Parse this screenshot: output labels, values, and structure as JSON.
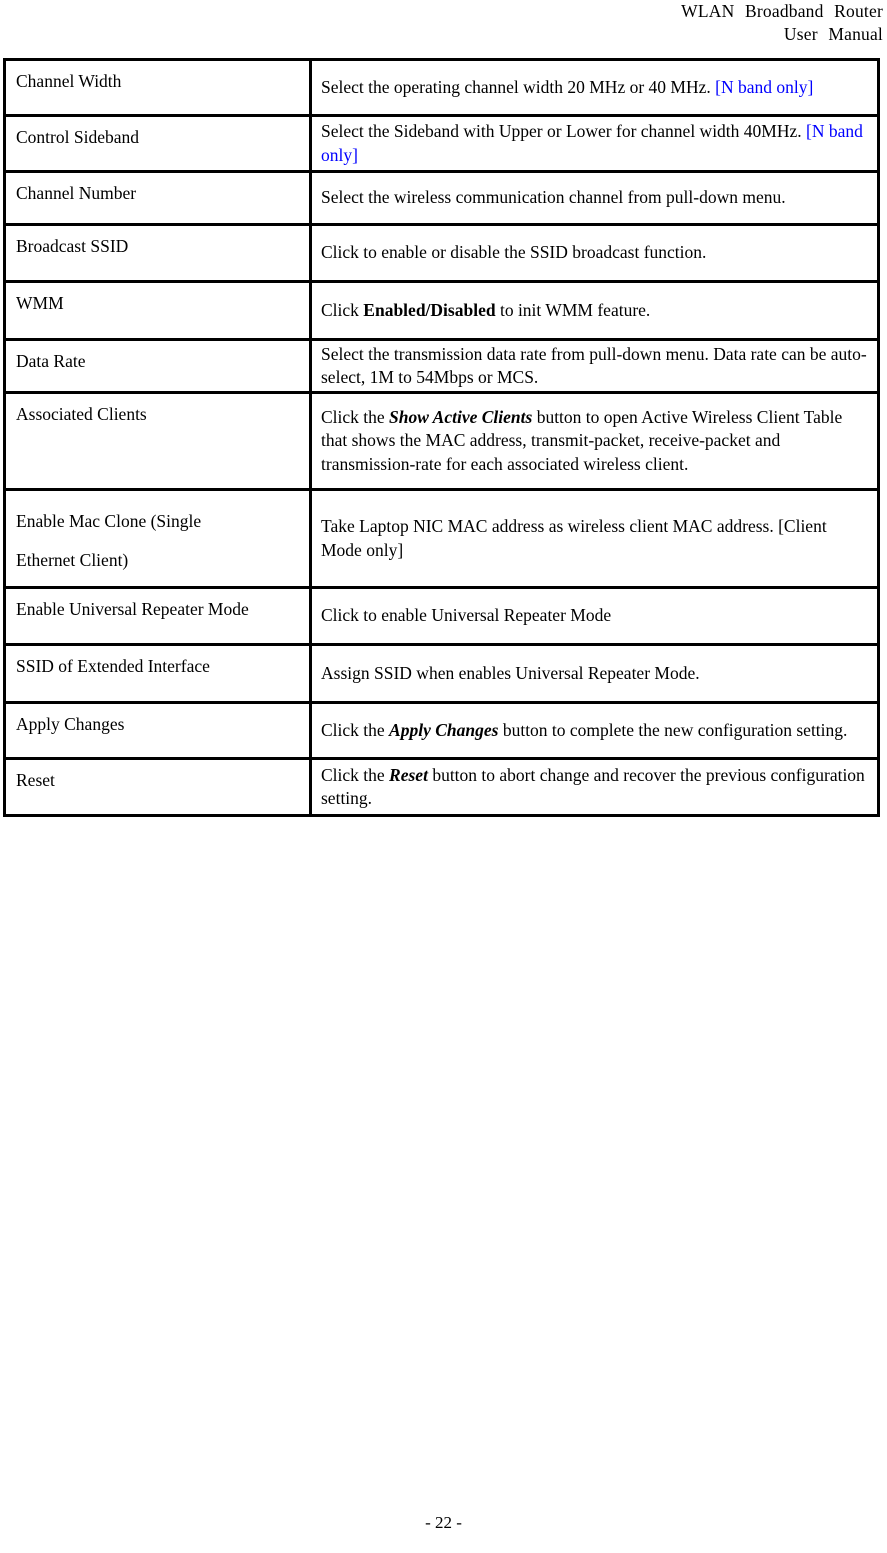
{
  "header": {
    "line1": "WLAN  Broadband  Router",
    "line2": "User  Manual"
  },
  "footer": {
    "page_label": "- 22 -"
  },
  "table": {
    "rows": [
      {
        "term": "Channel Width",
        "desc_plain": "Select the operating channel width 20 MHz or 40 MHz. [N band only]",
        "desc_parts": [
          {
            "text": "Select the operating channel width 20 MHz or 40 MHz.",
            "style": "normal"
          },
          {
            "text": " ",
            "style": "normal"
          },
          {
            "text": "[N band only]",
            "style": "blue"
          }
        ]
      },
      {
        "term": "Control Sideband",
        "desc_plain": "Select the Sideband with Upper or Lower for channel width 40MHz. [N band only]",
        "desc_parts": [
          {
            "text": "Select the Sideband with Upper or Lower for channel width 40MHz. ",
            "style": "normal"
          },
          {
            "text": "[N band only]",
            "style": "blue"
          }
        ]
      },
      {
        "term": "Channel Number",
        "desc_plain": "Select the wireless communication channel from pull-down menu.",
        "desc_parts": [
          {
            "text": "Select the wireless communication channel from pull-down menu.",
            "style": "normal"
          }
        ]
      },
      {
        "term": "Broadcast SSID",
        "desc_plain": "Click to enable or disable the SSID broadcast function.",
        "desc_parts": [
          {
            "text": "Click to enable or disable the SSID broadcast function.",
            "style": "normal"
          }
        ]
      },
      {
        "term": "WMM",
        "desc_plain": "Click Enabled/Disabled to init WMM feature.",
        "desc_parts": [
          {
            "text": "Click ",
            "style": "normal"
          },
          {
            "text": "Enabled/Disabled",
            "style": "bold"
          },
          {
            "text": " to init WMM feature.",
            "style": "normal"
          }
        ]
      },
      {
        "term": "Data Rate",
        "desc_plain": "Select the transmission data rate from pull-down menu. Data rate can be auto-select, 1M to 54Mbps or MCS.",
        "desc_parts": [
          {
            "text": "Select the transmission data rate from pull-down menu. Data rate can be auto-select, 1M to 54Mbps or MCS.",
            "style": "normal"
          }
        ]
      },
      {
        "term": "Associated Clients",
        "desc_plain": "Click the Show Active Clients button to open Active Wireless Client Table that shows the MAC address, transmit-packet, receive-packet and transmission-rate for each associated wireless client.",
        "desc_parts": [
          {
            "text": "Click the ",
            "style": "normal"
          },
          {
            "text": "Show Active Clients",
            "style": "bold-italic"
          },
          {
            "text": " button to open Active Wireless Client Table that shows the MAC address, transmit-packet, receive-packet and transmission-rate for each associated wireless client.",
            "style": "normal"
          }
        ]
      },
      {
        "term": "Enable Mac Clone (Single Ethernet Client)",
        "term_line1": "Enable Mac Clone (Single",
        "term_line2": "Ethernet Client)",
        "desc_plain": "Take Laptop NIC MAC address as wireless client MAC address. [Client Mode only]",
        "desc_parts": [
          {
            "text": "Take Laptop NIC MAC address as wireless client MAC address. [Client Mode only]",
            "style": "normal"
          }
        ]
      },
      {
        "term": "Enable Universal Repeater Mode",
        "desc_plain": "Click to enable Universal Repeater Mode",
        "desc_parts": [
          {
            "text": "Click to enable Universal Repeater Mode",
            "style": "normal"
          }
        ]
      },
      {
        "term": "SSID of Extended Interface",
        "desc_plain": "Assign SSID when enables Universal Repeater Mode.",
        "desc_parts": [
          {
            "text": "Assign SSID when enables Universal Repeater Mode.",
            "style": "normal"
          }
        ]
      },
      {
        "term": "Apply Changes",
        "desc_plain": "Click the Apply Changes button to complete the new configuration setting.",
        "desc_parts": [
          {
            "text": "Click the ",
            "style": "normal"
          },
          {
            "text": "Apply Changes",
            "style": "bold-italic"
          },
          {
            "text": " button to complete the new configuration setting.",
            "style": "normal"
          }
        ]
      },
      {
        "term": "Reset",
        "desc_plain": "Click the Reset button to abort change and recover the previous configuration setting.",
        "desc_parts": [
          {
            "text": "Click the ",
            "style": "normal"
          },
          {
            "text": "Reset",
            "style": "bold-italic"
          },
          {
            "text": " button to abort change and recover the previous configuration setting.",
            "style": "normal"
          }
        ]
      }
    ]
  },
  "colors": {
    "note_blue": "#0000ff",
    "text": "#000000",
    "border": "#000000",
    "background": "#ffffff"
  }
}
